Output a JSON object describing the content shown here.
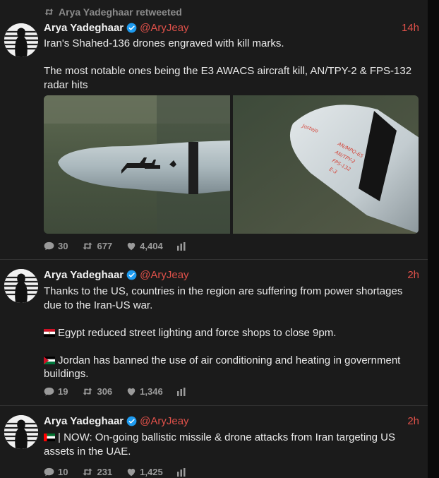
{
  "tweets": [
    {
      "retweeted_by": "Arya Yadeghaar retweeted",
      "name": "Arya Yadeghaar",
      "handle": "@AryJeay",
      "time": "14h",
      "lines": [
        "Iran's Shahed-136 drones engraved with kill marks.",
        "The most notable ones being the E3 AWACS aircraft kill, AN/TPY-2 & FPS-132 radar hits"
      ],
      "photo_markings": [
        "Jostejo",
        "AN/MPQ-65",
        "AN/TPY-2",
        "FPS-132",
        "E-3"
      ],
      "stats": {
        "replies": "30",
        "retweets": "677",
        "likes": "4,404"
      }
    },
    {
      "name": "Arya Yadeghaar",
      "handle": "@AryJeay",
      "time": "2h",
      "lines": [
        "Thanks to the US, countries in the region are suffering from power shortages due to the Iran-US war.",
        "Egypt reduced street lighting and force shops to close 9pm.",
        "Jordan has banned the use of air conditioning and heating in government buildings."
      ],
      "stats": {
        "replies": "19",
        "retweets": "306",
        "likes": "1,346"
      }
    },
    {
      "name": "Arya Yadeghaar",
      "handle": "@AryJeay",
      "time": "2h",
      "lines": [
        "| NOW: On-going ballistic missile & drone attacks from Iran targeting US assets in the UAE."
      ],
      "stats": {
        "replies": "10",
        "retweets": "231",
        "likes": "1,425"
      }
    }
  ],
  "icons": {
    "retweet": "retweet-icon",
    "verified": "verified-badge-icon",
    "reply": "reply-icon",
    "like": "heart-icon",
    "analytics": "analytics-icon"
  },
  "colors": {
    "background": "#1b1b1b",
    "accent": "#e0514a",
    "verified": "#1d9bf0",
    "muted": "#9a9a9a"
  }
}
